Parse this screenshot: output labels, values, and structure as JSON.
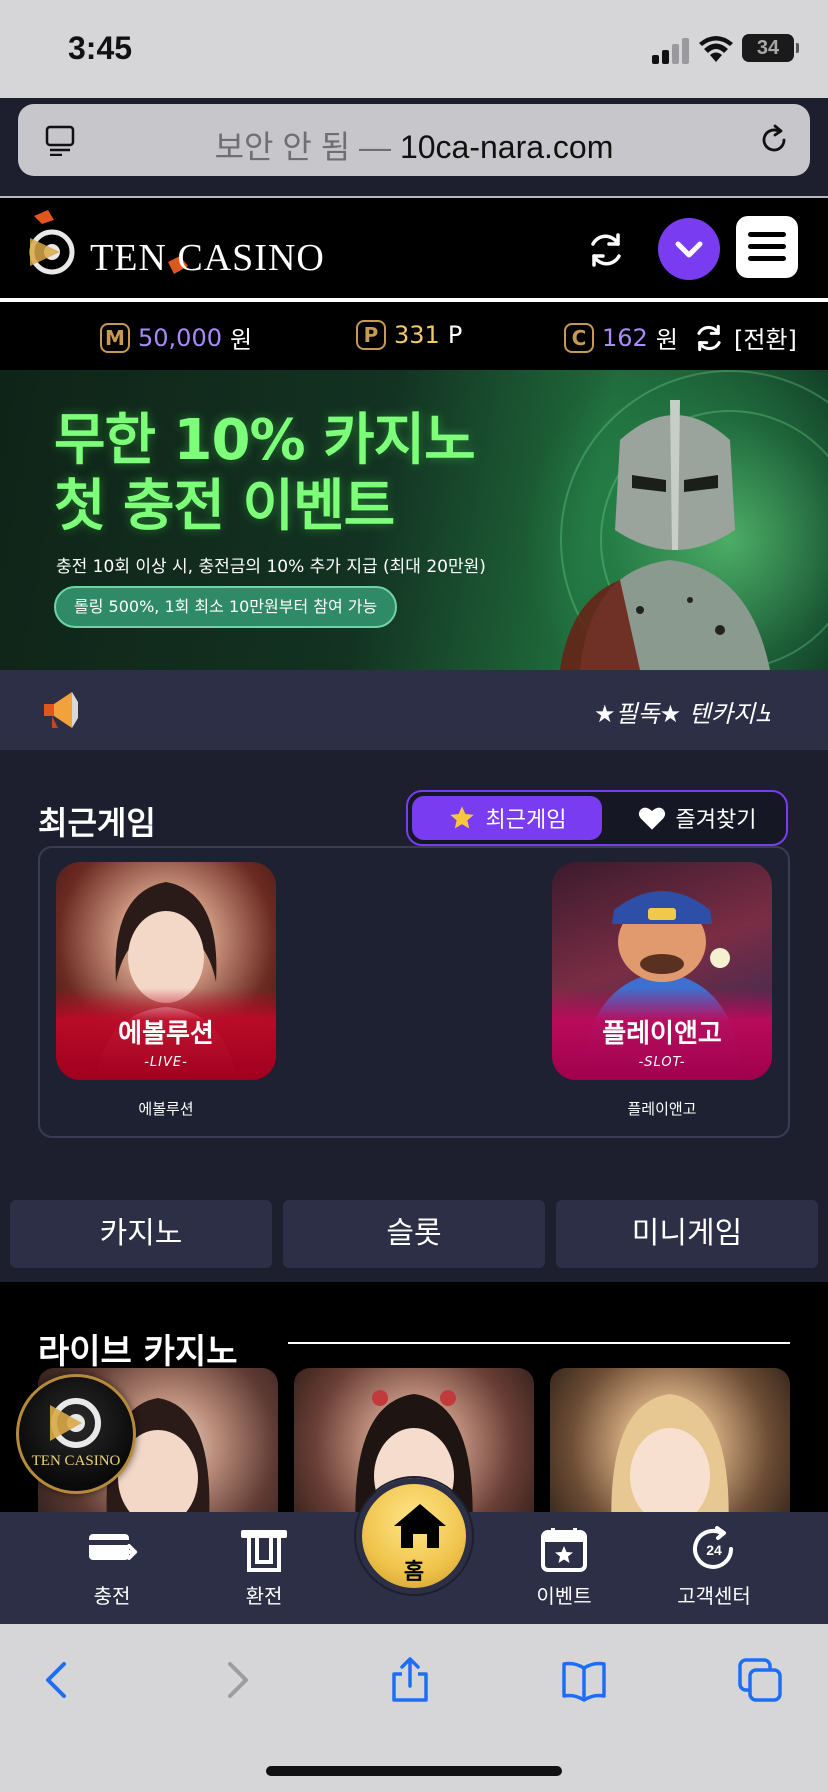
{
  "status_bar": {
    "time": "3:45",
    "battery": "34"
  },
  "browser": {
    "url_prefix": "보안 안 됨 —",
    "url_host": "10ca-nara.com"
  },
  "site": {
    "logo_text": "TEN CASINO",
    "accent_color": "#7a3cf0"
  },
  "balance": {
    "money": {
      "badge": "M",
      "value": "50,000",
      "unit": "원"
    },
    "points": {
      "badge": "P",
      "value": "331",
      "unit": "P"
    },
    "casino": {
      "badge": "C",
      "value": "162",
      "unit": "원"
    },
    "switch_label": "[전환]"
  },
  "banner": {
    "title_line1": "무한 10% 카지노",
    "title_line2": "첫 충전 이벤트",
    "description": "충전 10회 이상 시, 충전금의 10% 추가 지급 (최대 20만원)",
    "pill": "롤링 500%, 1회 최소 10만원부터 참여 가능"
  },
  "notice": {
    "text": "★필독★ 텐카지노"
  },
  "recent": {
    "title": "최근게임",
    "tab_recent": "최근게임",
    "tab_favorites": "즐겨찾기",
    "games": [
      {
        "name": "에볼루션",
        "type": "-LIVE-",
        "caption": "에볼루션"
      },
      {
        "name": "플레이앤고",
        "type": "-SLOT-",
        "caption": "플레이앤고"
      }
    ]
  },
  "categories": [
    "카지노",
    "슬롯",
    "미니게임"
  ],
  "live": {
    "title": "라이브 카지노"
  },
  "bottom_nav": {
    "deposit": "충전",
    "withdraw": "환전",
    "home": "홈",
    "event": "이벤트",
    "support": "고객센터"
  }
}
